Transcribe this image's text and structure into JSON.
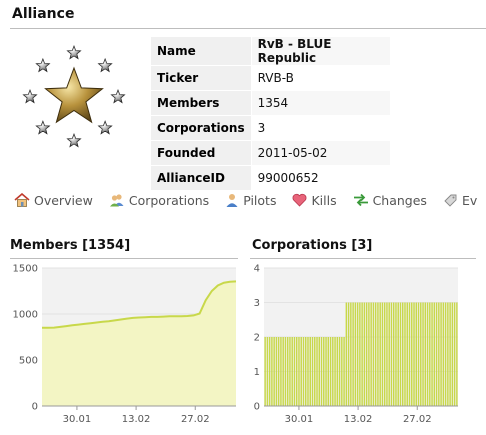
{
  "page": {
    "title": "Alliance"
  },
  "info": [
    {
      "key": "Name",
      "value": "RvB - BLUE Republic"
    },
    {
      "key": "Ticker",
      "value": "RVB-B"
    },
    {
      "key": "Members",
      "value": "1354"
    },
    {
      "key": "Corporations",
      "value": "3"
    },
    {
      "key": "Founded",
      "value": "2011-05-02"
    },
    {
      "key": "AllianceID",
      "value": "99000652"
    }
  ],
  "tabs": [
    {
      "label": "Overview",
      "icon": "house-icon"
    },
    {
      "label": "Corporations",
      "icon": "people-icon"
    },
    {
      "label": "Pilots",
      "icon": "person-icon"
    },
    {
      "label": "Kills",
      "icon": "heart-icon"
    },
    {
      "label": "Changes",
      "icon": "swap-arrows-icon"
    },
    {
      "label": "Ev",
      "icon": "tag-icon"
    }
  ],
  "colors": {
    "chart_line": "#c8d84a",
    "chart_fill": "#f3f5c4",
    "chart_bar": "#c8d84a",
    "chart_bg": "#f2f2f2"
  },
  "chart_data": [
    {
      "type": "area",
      "title": "Members [1354]",
      "ylim": [
        0,
        1500
      ],
      "yticks": [
        0,
        500,
        1000,
        1500
      ],
      "xticks": [
        "30.01",
        "13.02",
        "27.02"
      ],
      "values": [
        850,
        850,
        852,
        860,
        868,
        878,
        885,
        892,
        900,
        908,
        915,
        922,
        930,
        940,
        950,
        958,
        962,
        965,
        968,
        968,
        972,
        975,
        975,
        975,
        978,
        985,
        1005,
        1150,
        1250,
        1310,
        1340,
        1350,
        1354
      ]
    },
    {
      "type": "bar",
      "title": "Corporations [3]",
      "ylim": [
        0,
        4
      ],
      "yticks": [
        0,
        1,
        2,
        3,
        4
      ],
      "xticks": [
        "30.01",
        "13.02",
        "27.02"
      ],
      "values": [
        2,
        2,
        2,
        2,
        2,
        2,
        2,
        2,
        2,
        2,
        2,
        2,
        2,
        2,
        2,
        2,
        2,
        2,
        2,
        2,
        2,
        2,
        2,
        2,
        2,
        2,
        2,
        2,
        2,
        2,
        2,
        2,
        2,
        2,
        2,
        2,
        3,
        3,
        3,
        3,
        3,
        3,
        3,
        3,
        3,
        3,
        3,
        3,
        3,
        3,
        3,
        3,
        3,
        3,
        3,
        3,
        3,
        3,
        3,
        3,
        3,
        3,
        3,
        3,
        3,
        3,
        3,
        3,
        3,
        3,
        3,
        3,
        3,
        3,
        3,
        3,
        3,
        3,
        3,
        3,
        3,
        3,
        3,
        3,
        3,
        3
      ]
    }
  ]
}
